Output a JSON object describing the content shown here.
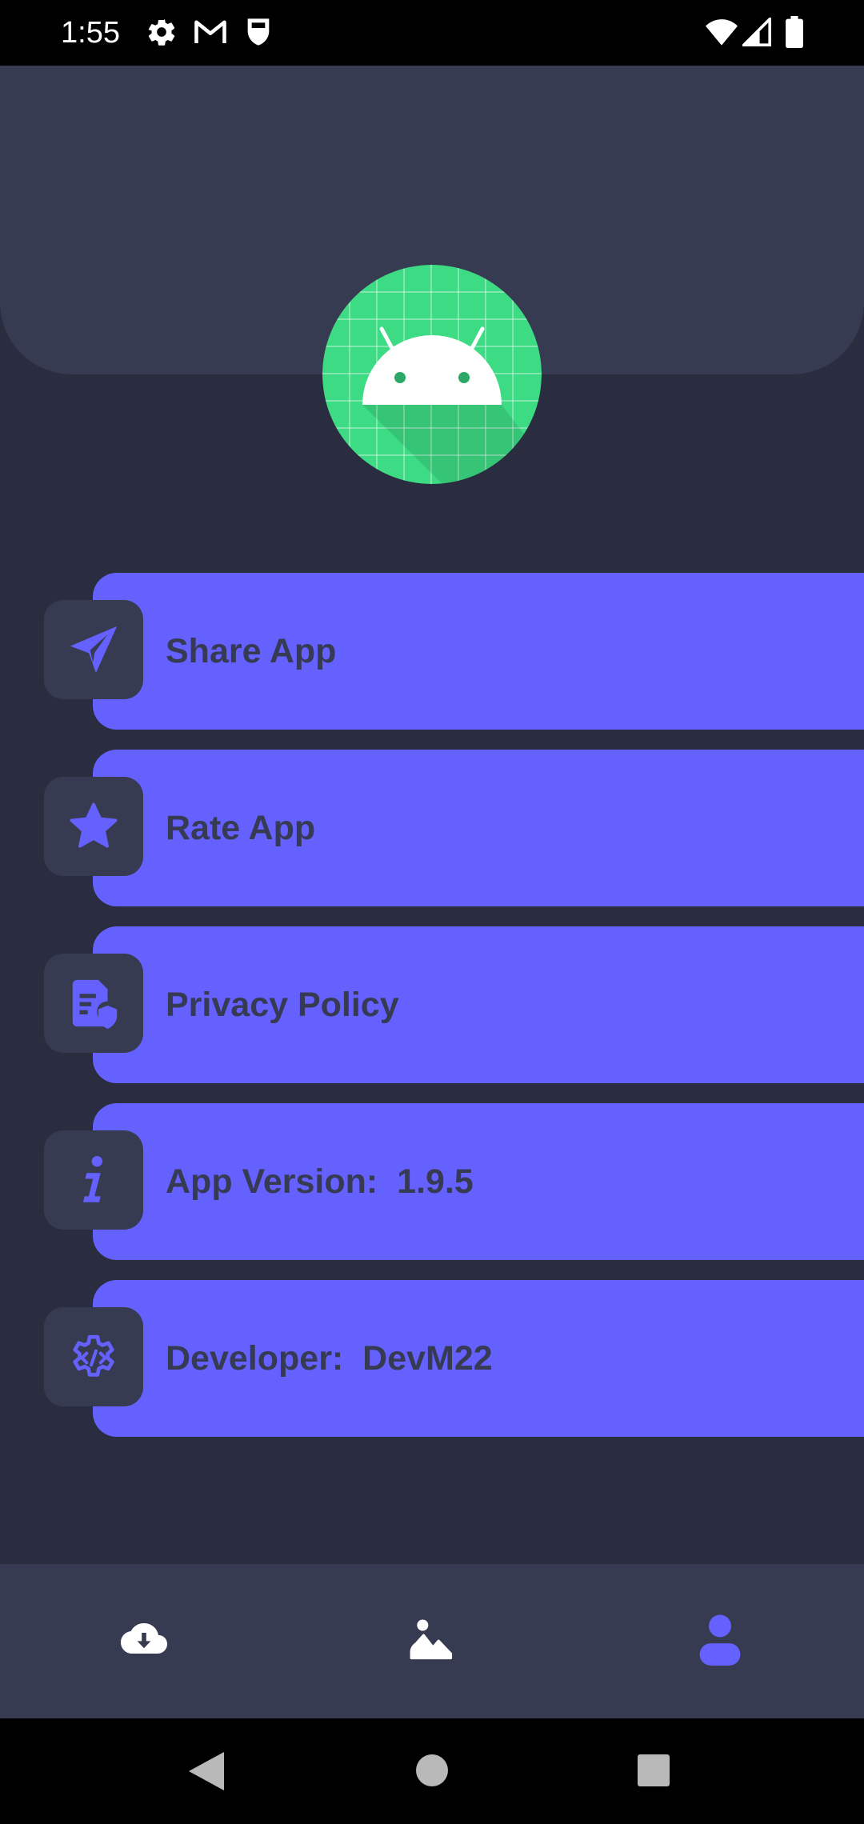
{
  "status_bar": {
    "time": "1:55",
    "icons": [
      "settings-icon",
      "gmail-icon",
      "shield-icon",
      "wifi-icon",
      "signal-icon",
      "battery-icon"
    ]
  },
  "header": {
    "logo_icon": "android-logo-icon"
  },
  "menu": [
    {
      "label": "Share App",
      "icon": "send-icon"
    },
    {
      "label": "Rate App",
      "icon": "star-icon"
    },
    {
      "label": "Privacy Policy",
      "icon": "privacy-policy-icon"
    },
    {
      "label": "App Version:  1.9.5",
      "icon": "info-icon"
    },
    {
      "label": "Developer:  DevM22",
      "icon": "developer-settings-icon"
    }
  ],
  "bottom_nav": {
    "items": [
      {
        "icon": "cloud-download-icon",
        "active": false
      },
      {
        "icon": "gallery-icon",
        "active": false
      },
      {
        "icon": "profile-icon",
        "active": true
      }
    ],
    "active_color": "#6561fe",
    "inactive_color": "#ffffff"
  },
  "system_nav": [
    "back-icon",
    "home-icon",
    "recents-icon"
  ],
  "colors": {
    "background": "#292d3f",
    "surface": "#373b51",
    "accent": "#6561fe",
    "label_text": "#363a52"
  }
}
